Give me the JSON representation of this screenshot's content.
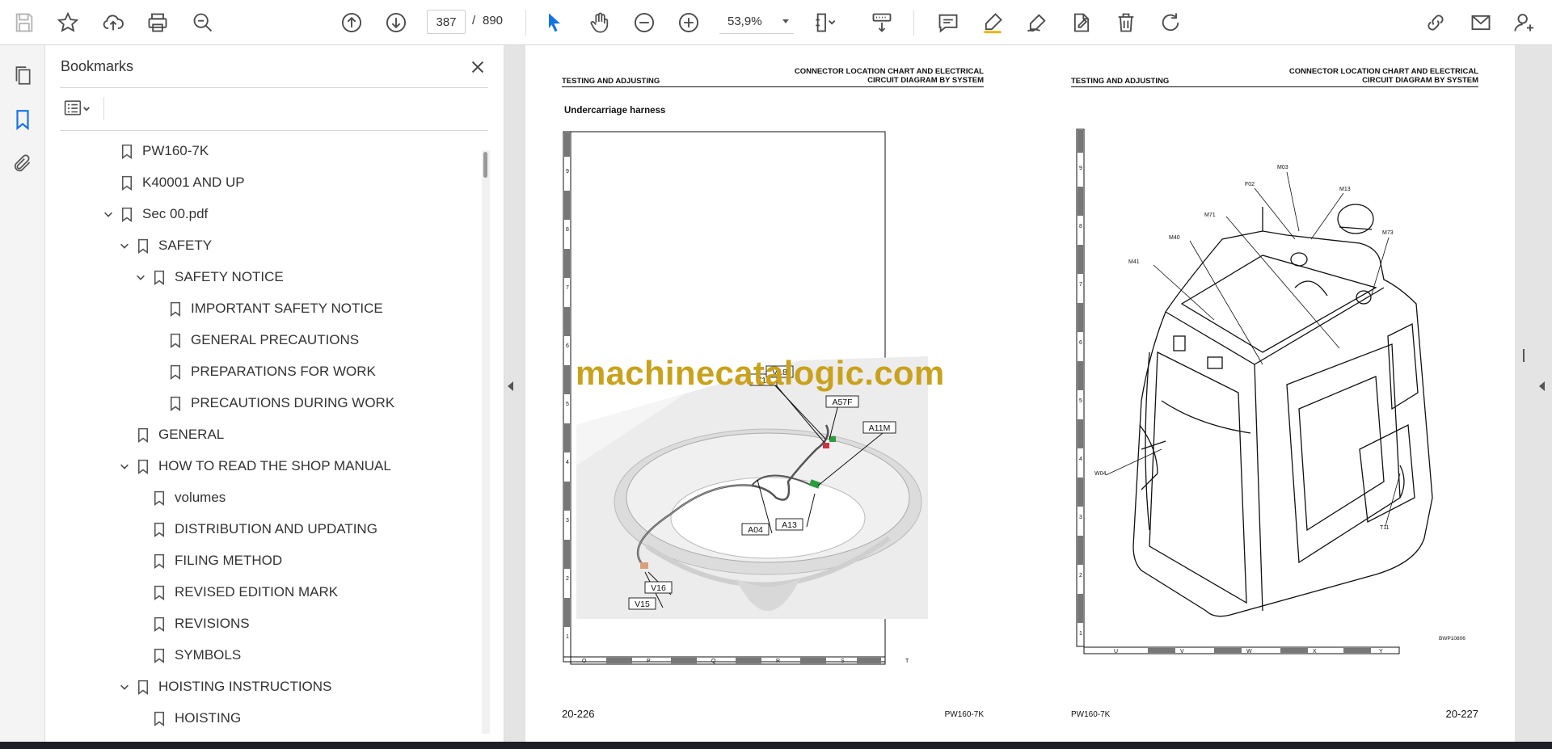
{
  "toolbar": {
    "page_current": "387",
    "page_separator": "/",
    "page_total": "890",
    "zoom_value": "53,9%"
  },
  "panel": {
    "title": "Bookmarks",
    "bookmarks": [
      {
        "label": "PW160-7K",
        "level": 0,
        "chevron": "none"
      },
      {
        "label": "K40001 AND UP",
        "level": 0,
        "chevron": "none"
      },
      {
        "label": "Sec 00.pdf",
        "level": 0,
        "chevron": "open"
      },
      {
        "label": "SAFETY",
        "level": 1,
        "chevron": "open"
      },
      {
        "label": "SAFETY NOTICE",
        "level": 2,
        "chevron": "open"
      },
      {
        "label": "IMPORTANT SAFETY NOTICE",
        "level": 3,
        "chevron": "none"
      },
      {
        "label": "GENERAL PRECAUTIONS",
        "level": 3,
        "chevron": "none"
      },
      {
        "label": "PREPARATIONS FOR WORK",
        "level": 3,
        "chevron": "none"
      },
      {
        "label": "PRECAUTIONS DURING WORK",
        "level": 3,
        "chevron": "none"
      },
      {
        "label": "GENERAL",
        "level": 1,
        "chevron": "none"
      },
      {
        "label": "HOW TO READ THE SHOP MANUAL",
        "level": 1,
        "chevron": "open"
      },
      {
        "label": "volumes",
        "level": 2,
        "chevron": "none"
      },
      {
        "label": "DISTRIBUTION AND UPDATING",
        "level": 2,
        "chevron": "none"
      },
      {
        "label": "FILING METHOD",
        "level": 2,
        "chevron": "none"
      },
      {
        "label": "REVISED EDITION MARK",
        "level": 2,
        "chevron": "none"
      },
      {
        "label": "REVISIONS",
        "level": 2,
        "chevron": "none"
      },
      {
        "label": "SYMBOLS",
        "level": 2,
        "chevron": "none"
      },
      {
        "label": "HOISTING INSTRUCTIONS",
        "level": 1,
        "chevron": "open"
      },
      {
        "label": "HOISTING",
        "level": 2,
        "chevron": "none"
      }
    ]
  },
  "left_page": {
    "header_left": "TESTING AND ADJUSTING",
    "header_right_1": "CONNECTOR LOCATION CHART AND ELECTRICAL",
    "header_right_2": "CIRCUIT DIAGRAM BY SYSTEM",
    "caption": "Undercarriage harness",
    "callouts": [
      "V17",
      "V18",
      "A57F",
      "A11M",
      "A04",
      "A13",
      "V16",
      "V15"
    ],
    "grid_letters": [
      "O",
      "P",
      "Q",
      "R",
      "S",
      "T"
    ],
    "grid_numbers": [
      "9",
      "8",
      "7",
      "6",
      "5",
      "4",
      "3",
      "2",
      "1"
    ],
    "footer_number": "20-226",
    "footer_model": "PW160-7K"
  },
  "right_page": {
    "header_left": "TESTING AND ADJUSTING",
    "header_right_1": "CONNECTOR LOCATION CHART AND ELECTRICAL",
    "header_right_2": "CIRCUIT DIAGRAM BY SYSTEM",
    "callouts": [
      "M03",
      "F02",
      "M13",
      "M71",
      "M40",
      "M73",
      "M41",
      "W04",
      "T11"
    ],
    "grid_letters": [
      "U",
      "V",
      "W",
      "X",
      "Y"
    ],
    "grid_numbers": [
      "9",
      "8",
      "7",
      "6",
      "5",
      "4",
      "3",
      "2",
      "1"
    ],
    "drawing_code": "BWP10806",
    "footer_number": "20-227",
    "footer_model": "PW160-7K"
  },
  "watermark": "machinecatalogic.com",
  "colors": {
    "accent": "#1473e6",
    "watermark": "#c9a21c",
    "toolbar_icon": "#4b4b4b"
  }
}
